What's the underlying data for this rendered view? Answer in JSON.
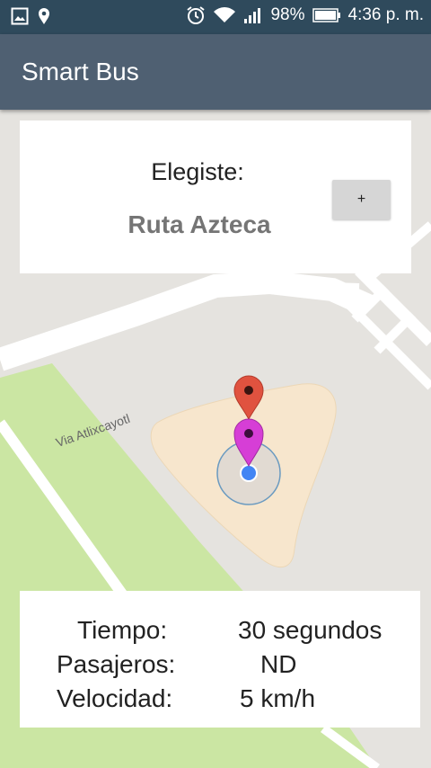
{
  "status_bar": {
    "battery": "98%",
    "time": "4:36 p. m."
  },
  "app_bar": {
    "title": "Smart Bus"
  },
  "map": {
    "road_label": "Via Atlixcayotl"
  },
  "route_card": {
    "label": "Elegiste:",
    "route_name": "Ruta Azteca",
    "add_button": "+"
  },
  "info_card": {
    "rows": [
      {
        "label": "Tiempo:",
        "value": "30 segundos"
      },
      {
        "label": "Pasajeros:",
        "value": "ND"
      },
      {
        "label": "Velocidad:",
        "value": "5 km/h"
      }
    ]
  },
  "colors": {
    "status_bar": "#2f4a5c",
    "app_bar": "#4f6072",
    "park": "#cbe6a3",
    "zone": "#f7e6cd",
    "marker_red": "#e0523f",
    "marker_magenta": "#d63ed6",
    "location_dot": "#4285f4"
  }
}
